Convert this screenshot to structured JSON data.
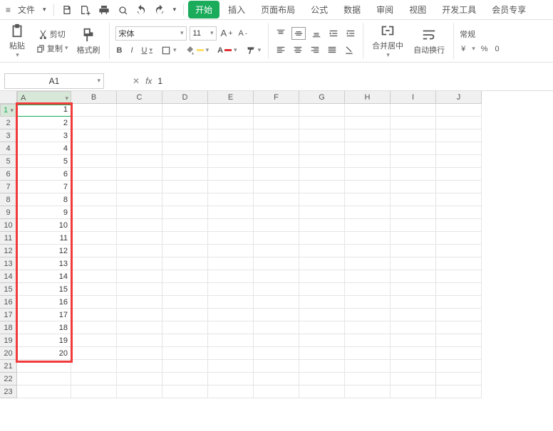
{
  "menu": {
    "file": "文件"
  },
  "tabs": {
    "start": "开始",
    "insert": "插入",
    "layout": "页面布局",
    "formula": "公式",
    "data": "数据",
    "review": "审阅",
    "view": "视图",
    "dev": "开发工具",
    "member": "会员专享"
  },
  "clipboard": {
    "paste": "粘贴",
    "cut": "剪切",
    "copy": "复制",
    "format": "格式刷"
  },
  "font": {
    "name": "宋体",
    "size": "11"
  },
  "merge": "合并居中",
  "wrap": "自动换行",
  "number_format": "常规",
  "namebox": "A1",
  "formula": "1",
  "columns": [
    "A",
    "B",
    "C",
    "D",
    "E",
    "F",
    "G",
    "H",
    "I",
    "J"
  ],
  "rows": [
    "1",
    "2",
    "3",
    "4",
    "5",
    "6",
    "7",
    "8",
    "9",
    "10",
    "11",
    "12",
    "13",
    "14",
    "15",
    "16",
    "17",
    "18",
    "19",
    "20",
    "21",
    "22",
    "23"
  ],
  "cells_colA": [
    "1",
    "2",
    "3",
    "4",
    "5",
    "6",
    "7",
    "8",
    "9",
    "10",
    "11",
    "12",
    "13",
    "14",
    "15",
    "16",
    "17",
    "18",
    "19",
    "20"
  ],
  "symbols": {
    "yen": "¥",
    "percent": "%",
    "thou": "0"
  }
}
